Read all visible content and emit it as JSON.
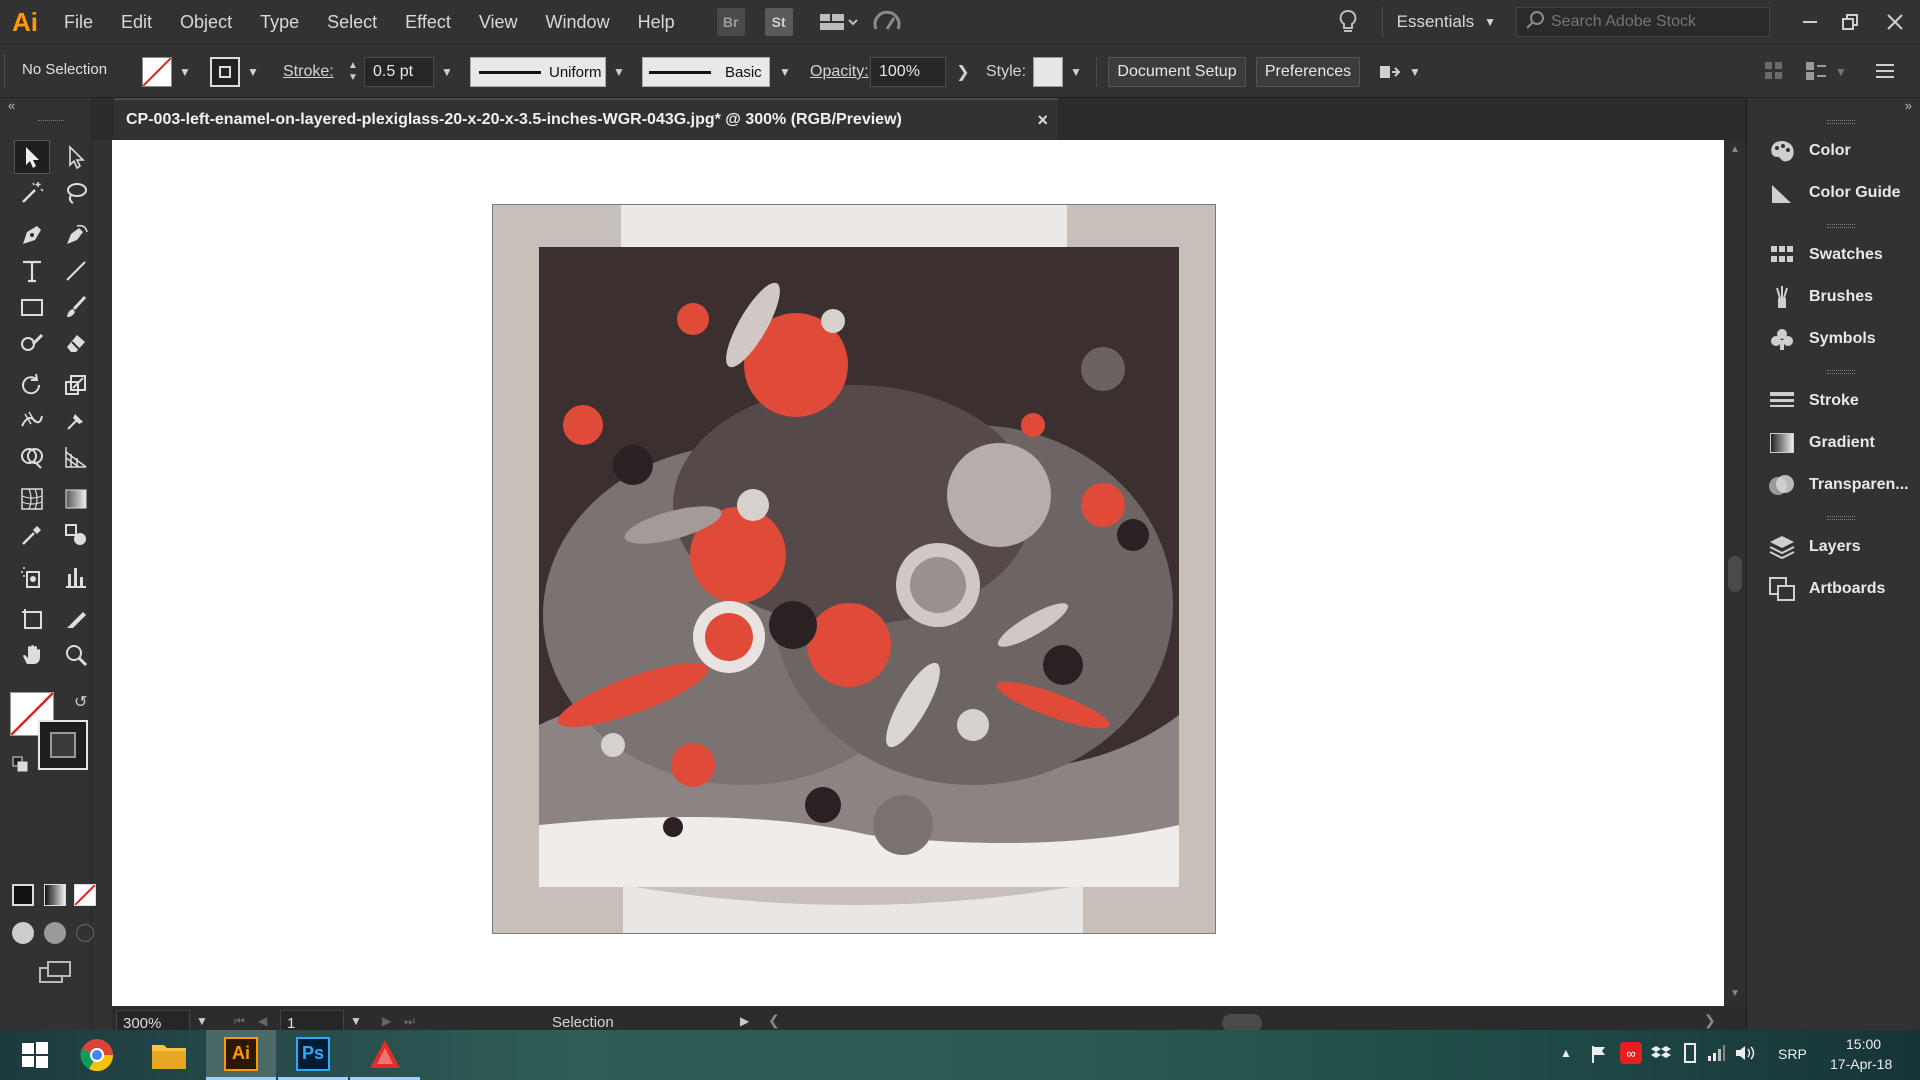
{
  "menubar": {
    "logo": "Ai",
    "items": [
      "File",
      "Edit",
      "Object",
      "Type",
      "Select",
      "Effect",
      "View",
      "Window",
      "Help"
    ],
    "bridge": "Br",
    "stock": "St",
    "workspace": "Essentials",
    "search_placeholder": "Search Adobe Stock"
  },
  "control": {
    "selection_label": "No Selection",
    "stroke_label": "Stroke:",
    "stroke_weight": "0.5 pt",
    "profile": "Uniform",
    "brush": "Basic",
    "opacity_label": "Opacity:",
    "opacity_value": "100%",
    "style_label": "Style:",
    "document_setup": "Document Setup",
    "preferences": "Preferences"
  },
  "document": {
    "tab_title": "CP-003-left-enamel-on-layered-plexiglass-20-x-20-x-3.5-inches-WGR-043G.jpg* @ 300% (RGB/Preview)",
    "close": "×"
  },
  "status": {
    "zoom": "300%",
    "artboard": "1",
    "tool_name": "Selection"
  },
  "panels": {
    "group1": [
      "Color",
      "Color Guide"
    ],
    "group2": [
      "Swatches",
      "Brushes",
      "Symbols"
    ],
    "group3": [
      "Stroke",
      "Gradient",
      "Transparen..."
    ],
    "group4": [
      "Layers",
      "Artboards"
    ]
  },
  "taskbar": {
    "tray_lang": "SRP",
    "time": "15:00",
    "date": "17-Apr-18",
    "apps": [
      "chrome-icon",
      "file-explorer-icon",
      "illustrator-icon",
      "photoshop-icon",
      "acrobat-icon"
    ],
    "illustrator_label": "Ai",
    "photoshop_label": "Ps"
  },
  "colors": {
    "accent_orange": "#ff9a00",
    "artwork_red": "#e04a38",
    "artwork_dark": "#3b2f2f",
    "artwork_gray": "#8c8482"
  }
}
